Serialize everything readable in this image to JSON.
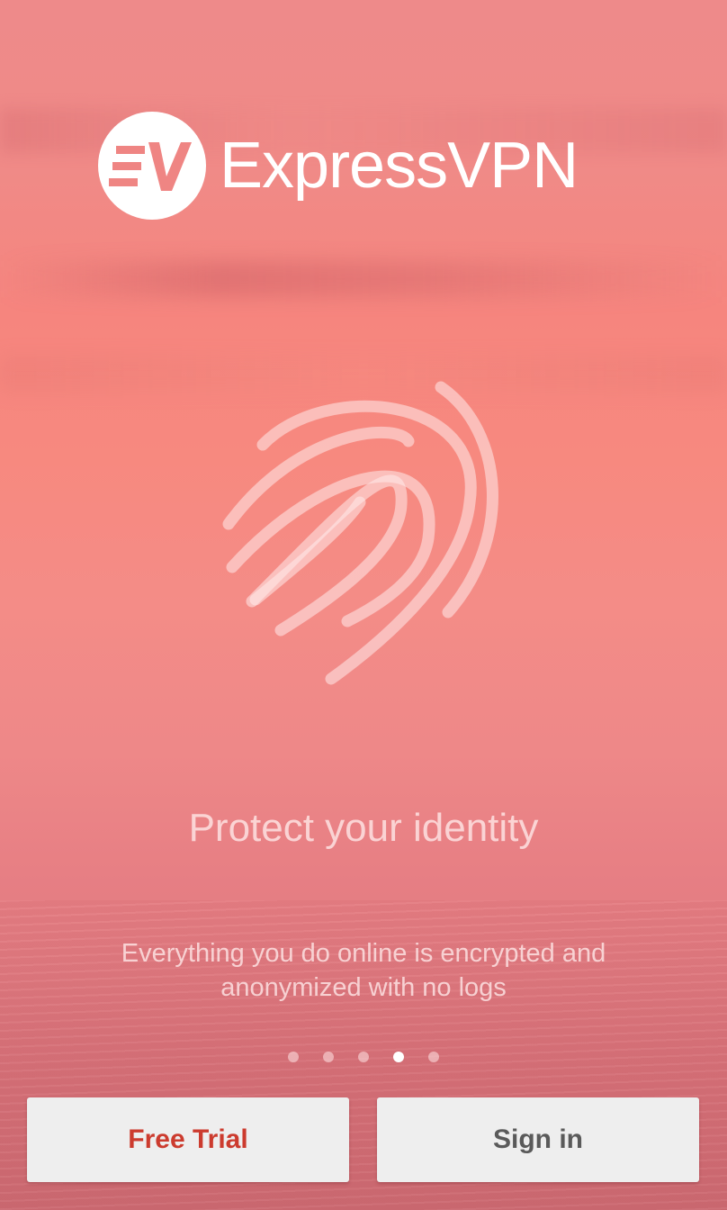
{
  "brand": {
    "logo_mark": "EV",
    "name": "ExpressVPN"
  },
  "illustration": {
    "icon": "fingerprint-icon"
  },
  "slide": {
    "title": "Protect your identity",
    "description": "Everything you do online is encrypted and anonymized with no logs"
  },
  "pager": {
    "total": 5,
    "current": 4
  },
  "actions": {
    "free_trial_label": "Free Trial",
    "sign_in_label": "Sign in"
  },
  "colors": {
    "accent_red": "#cc3b2e",
    "button_bg": "#eeeeee",
    "button_text_gray": "#5a5a5a"
  }
}
